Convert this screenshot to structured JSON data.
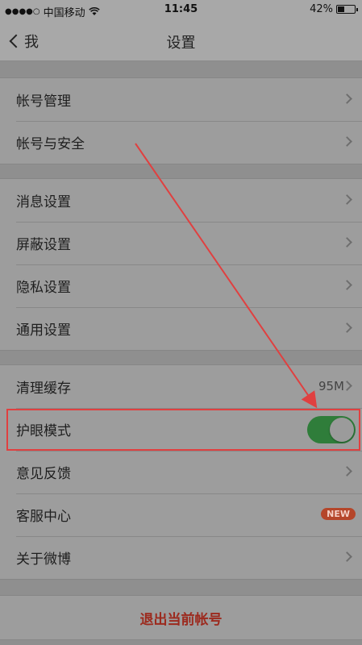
{
  "status_bar": {
    "signal_dots": "●●●●○",
    "carrier": "中国移动",
    "wifi_icon": "wifi-icon",
    "time": "11:45",
    "battery_text": "42%",
    "battery_level": 0.42
  },
  "nav": {
    "back_label": "我",
    "title": "设置"
  },
  "groups": {
    "account": [
      {
        "label": "帐号管理"
      },
      {
        "label": "帐号与安全"
      }
    ],
    "settings": [
      {
        "label": "消息设置"
      },
      {
        "label": "屏蔽设置"
      },
      {
        "label": "隐私设置"
      },
      {
        "label": "通用设置"
      }
    ],
    "misc": {
      "clear_cache": {
        "label": "清理缓存",
        "value": "95M"
      },
      "eye_mode": {
        "label": "护眼模式",
        "enabled": true
      },
      "feedback": {
        "label": "意见反馈"
      },
      "service": {
        "label": "客服中心",
        "badge": "NEW"
      },
      "about": {
        "label": "关于微博"
      }
    }
  },
  "logout_label": "退出当前帐号",
  "colors": {
    "annotation": "#e04040",
    "toggle_on": "#2f7d3a",
    "logout_text": "#9c2a1e"
  }
}
